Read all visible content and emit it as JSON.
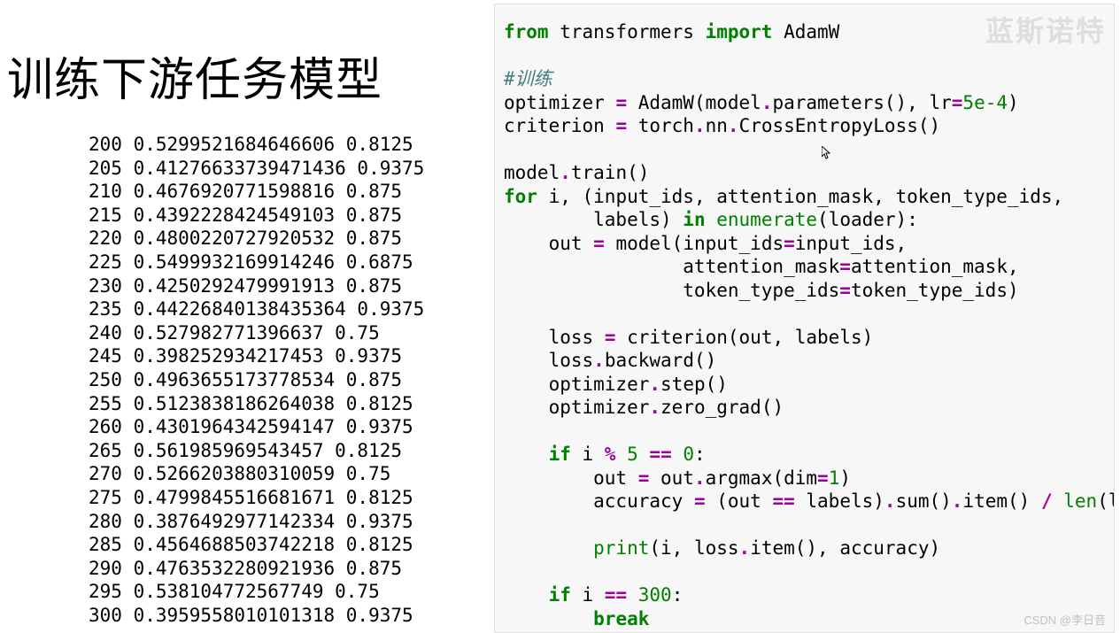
{
  "title": "训练下游任务模型",
  "log_rows": [
    {
      "step": "200",
      "loss": "0.5299521684646606",
      "acc": "0.8125"
    },
    {
      "step": "205",
      "loss": "0.41276633739471436",
      "acc": "0.9375"
    },
    {
      "step": "210",
      "loss": "0.4676920771598816",
      "acc": "0.875"
    },
    {
      "step": "215",
      "loss": "0.4392228424549103",
      "acc": "0.875"
    },
    {
      "step": "220",
      "loss": "0.4800220727920532",
      "acc": "0.875"
    },
    {
      "step": "225",
      "loss": "0.5499932169914246",
      "acc": "0.6875"
    },
    {
      "step": "230",
      "loss": "0.4250292479991913",
      "acc": "0.875"
    },
    {
      "step": "235",
      "loss": "0.44226840138435364",
      "acc": "0.9375"
    },
    {
      "step": "240",
      "loss": "0.527982771396637",
      "acc": "0.75"
    },
    {
      "step": "245",
      "loss": "0.398252934217453",
      "acc": "0.9375"
    },
    {
      "step": "250",
      "loss": "0.4963655173778534",
      "acc": "0.875"
    },
    {
      "step": "255",
      "loss": "0.5123838186264038",
      "acc": "0.8125"
    },
    {
      "step": "260",
      "loss": "0.4301964342594147",
      "acc": "0.9375"
    },
    {
      "step": "265",
      "loss": "0.561985969543457",
      "acc": "0.8125"
    },
    {
      "step": "270",
      "loss": "0.5266203880310059",
      "acc": "0.75"
    },
    {
      "step": "275",
      "loss": "0.4799845516681671",
      "acc": "0.8125"
    },
    {
      "step": "280",
      "loss": "0.3876492977142334",
      "acc": "0.9375"
    },
    {
      "step": "285",
      "loss": "0.4564688503742218",
      "acc": "0.8125"
    },
    {
      "step": "290",
      "loss": "0.4763532280921936",
      "acc": "0.875"
    },
    {
      "step": "295",
      "loss": "0.538104772567749",
      "acc": "0.75"
    },
    {
      "step": "300",
      "loss": "0.3959558010101318",
      "acc": "0.9375"
    }
  ],
  "code": {
    "l1_from": "from",
    "l1_mod": " transformers ",
    "l1_import": "import",
    "l1_name": " AdamW",
    "l3_comment": "#训练",
    "l4_a": "optimizer ",
    "l4_eq": "=",
    "l4_b": " AdamW(model",
    "l4_dot1": ".",
    "l4_c": "parameters(), lr",
    "l4_eq2": "=",
    "l4_lr": "5e-4",
    "l4_rp": ")",
    "l5_a": "criterion ",
    "l5_eq": "=",
    "l5_b": " torch",
    "l5_d1": ".",
    "l5_c": "nn",
    "l5_d2": ".",
    "l5_d": "CrossEntropyLoss()",
    "l7_a": "model",
    "l7_d": ".",
    "l7_b": "train()",
    "l8_for": "for",
    "l8_a": " i, (input_ids, attention_mask, token_type_ids,",
    "l9_a": "        labels) ",
    "l9_in": "in",
    "l9_sp": " ",
    "l9_fn": "enumerate",
    "l9_b": "(loader):",
    "l10_a": "    out ",
    "l10_eq": "=",
    "l10_b": " model(input_ids",
    "l10_eq2": "=",
    "l10_c": "input_ids,",
    "l11_a": "                attention_mask",
    "l11_eq": "=",
    "l11_b": "attention_mask,",
    "l12_a": "                token_type_ids",
    "l12_eq": "=",
    "l12_b": "token_type_ids)",
    "l14_a": "    loss ",
    "l14_eq": "=",
    "l14_b": " criterion(out, labels)",
    "l15_a": "    loss",
    "l15_d": ".",
    "l15_b": "backward()",
    "l16_a": "    optimizer",
    "l16_d": ".",
    "l16_b": "step()",
    "l17_a": "    optimizer",
    "l17_d": ".",
    "l17_b": "zero_grad()",
    "l19_if": "    if",
    "l19_a": " i ",
    "l19_mod": "%",
    "l19_sp": " ",
    "l19_n5": "5",
    "l19_sp2": " ",
    "l19_eq": "==",
    "l19_sp3": " ",
    "l19_n0": "0",
    "l19_colon": ":",
    "l20_a": "        out ",
    "l20_eq": "=",
    "l20_b": " out",
    "l20_d": ".",
    "l20_c": "argmax(dim",
    "l20_eq2": "=",
    "l20_n1": "1",
    "l20_rp": ")",
    "l21_a": "        accuracy ",
    "l21_eq": "=",
    "l21_b": " (out ",
    "l21_eqeq": "==",
    "l21_c": " labels)",
    "l21_d1": ".",
    "l21_sum": "sum()",
    "l21_d2": ".",
    "l21_item": "item() ",
    "l21_div": "/",
    "l21_sp": " ",
    "l21_len": "len",
    "l21_lab": "(labels)",
    "l23_pad": "        ",
    "l23_print": "print",
    "l23_a": "(i, loss",
    "l23_d": ".",
    "l23_b": "item(), accuracy)",
    "l25_if": "    if",
    "l25_a": " i ",
    "l25_eq": "==",
    "l25_sp": " ",
    "l25_n": "300",
    "l25_colon": ":",
    "l26_pad": "        ",
    "l26_break": "break"
  },
  "watermark_tr": "蓝斯诺特",
  "watermark_br": "CSDN @李日音"
}
